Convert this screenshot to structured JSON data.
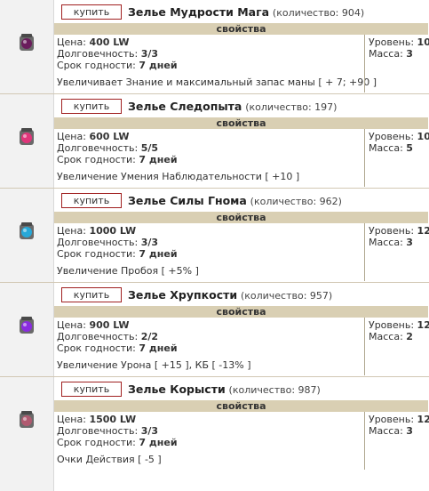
{
  "labels": {
    "buy": "купить",
    "properties": "свойства",
    "price": "Цена:",
    "durability": "Долговечность:",
    "expiry": "Срок годности:",
    "level": "Уровень:",
    "mass": "Масса:"
  },
  "items": [
    {
      "name": "Зелье Мудрости Мага",
      "qty": "(количество: 904)",
      "price": "400 LW",
      "durability": "3/3",
      "expiry": "7 дней",
      "effect": "Увеличивает Знание и максимальный запас маны [ + 7; +90 ]",
      "level": "10",
      "mass": "3",
      "icon": "potion-dark-icon",
      "color": "#6a1d5c"
    },
    {
      "name": "Зелье Следопыта",
      "qty": "(количество: 197)",
      "price": "600 LW",
      "durability": "5/5",
      "expiry": "7 дней",
      "effect": "Увеличение Умения Наблюдательности [ +10 ]",
      "level": "10",
      "mass": "5",
      "icon": "potion-pink-icon",
      "color": "#e0357a"
    },
    {
      "name": "Зелье Силы Гнома",
      "qty": "(количество: 962)",
      "price": "1000 LW",
      "durability": "3/3",
      "expiry": "7 дней",
      "effect": "Увеличение Пробоя [ +5% ]",
      "level": "12",
      "mass": "3",
      "icon": "potion-cyan-icon",
      "color": "#27a8d8"
    },
    {
      "name": "Зелье Хрупкости",
      "qty": "(количество: 957)",
      "price": "900 LW",
      "durability": "2/2",
      "expiry": "7 дней",
      "effect": "Увеличение Урона [ +15 ], КБ [ -13% ]",
      "level": "12",
      "mass": "2",
      "icon": "potion-purple-icon",
      "color": "#8a2be0"
    },
    {
      "name": "Зелье Корысти",
      "qty": "(количество: 987)",
      "price": "1500 LW",
      "durability": "3/3",
      "expiry": "7 дней",
      "effect": "Очки Действия [ -5 ]",
      "level": "12",
      "mass": "3",
      "icon": "potion-mauve-icon",
      "color": "#b05a70"
    }
  ]
}
